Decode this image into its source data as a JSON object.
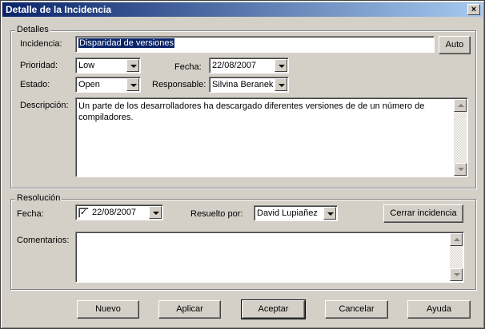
{
  "window": {
    "title": "Detalle de la Incidencia",
    "close_glyph": "×"
  },
  "detalles": {
    "legend": "Detalles",
    "incidencia_label": "Incidencia:",
    "incidencia_value": "Disparidad de versiones",
    "auto_button": "Auto",
    "prioridad_label": "Prioridad:",
    "prioridad_value": "Low",
    "fecha_label": "Fecha:",
    "fecha_value": "22/08/2007",
    "estado_label": "Estado:",
    "estado_value": "Open",
    "responsable_label": "Responsable:",
    "responsable_value": "Silvina Beranek",
    "descripcion_label": "Descripción:",
    "descripcion_value": "Un parte de los desarrolladores ha descargado diferentes versiones de de un número de compiladores."
  },
  "resolucion": {
    "legend": "Resolución",
    "fecha_label": "Fecha:",
    "fecha_checked": true,
    "fecha_value": "22/08/2007",
    "resuelto_label": "Resuelto por:",
    "resuelto_value": "David Lupiañez",
    "cerrar_button": "Cerrar incidencia",
    "comentarios_label": "Comentarios:",
    "comentarios_value": ""
  },
  "buttons": {
    "nuevo": "Nuevo",
    "aplicar": "Aplicar",
    "aceptar": "Aceptar",
    "cancelar": "Cancelar",
    "ayuda": "Ayuda"
  }
}
